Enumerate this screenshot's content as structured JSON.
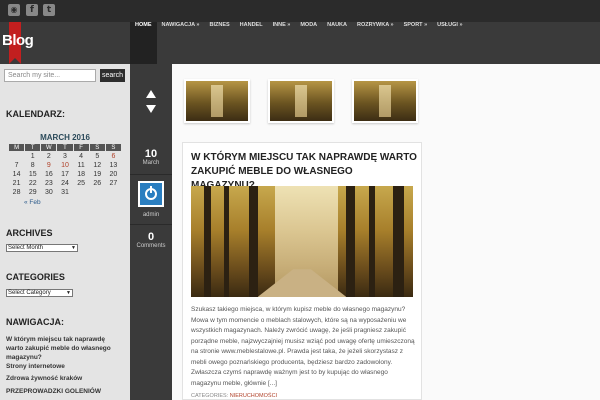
{
  "header": {
    "logo": "Blog",
    "nav": [
      "HOME",
      "NAWIGACJA »",
      "BIZNES",
      "HANDEL",
      "INNE »",
      "MODA",
      "NAUKA",
      "ROZRYWKA »",
      "SPORT »",
      "USŁUGI »"
    ]
  },
  "social": {
    "rss": "rss-icon",
    "facebook": "f",
    "twitter": "t"
  },
  "sidebar": {
    "search_placeholder": "Search my site...",
    "search_button": "search",
    "calendar_heading": "KALENDARZ:",
    "calendar_title": "MARCH 2016",
    "weekdays": [
      "M",
      "T",
      "W",
      "T",
      "F",
      "S",
      "S"
    ],
    "calendar_prev": "« Feb",
    "archives_heading": "ARCHIVES",
    "archives_select": "Select Month",
    "categories_heading": "CATEGORIES",
    "categories_select": "Select Category",
    "nav_heading": "NAWIGACJA:",
    "links": [
      "W którym miejscu tak naprawdę warto zakupić meble do własnego magazynu?",
      "Strony internetowe",
      "Zdrowa żywność kraków",
      "PRZEPROWADZKI GOLENIÓW"
    ]
  },
  "meta": {
    "day": "10",
    "month": "March",
    "author": "admin",
    "comments_count": "0",
    "comments_label": "Comments"
  },
  "post": {
    "title": "W którym miejscu tak naprawdę warto zakupić meble do własnego magazynu?",
    "body": "Szukasz takiego miejsca, w którym kupisz meble do własnego magazynu? Mowa w tym momencie o meblach stalowych, które są na wyposażeniu we wszystkich magazynach. Należy zwrócić uwagę, że jeśli pragniesz zakupić porządne meble, najzwyczajniej musisz wziąć pod uwagę ofertę umieszczoną na stronie www.meblestalowe.pl. Prawda jest taka, że jeżeli skorzystasz z mebli owego poznańskiego producenta, będziesz bardzo zadowolony. Zwłaszcza czymś naprawdę ważnym jest to by kupując do własnego magazynu meble, głównie [...]",
    "category_label": "CATEGORIES:",
    "category": "NIERUCHOMOŚCI"
  }
}
